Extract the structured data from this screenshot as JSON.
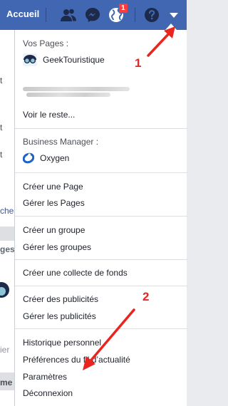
{
  "topbar": {
    "home_label": "Accueil",
    "notification_badge": "1",
    "colors": {
      "background": "#4267b2",
      "badge": "#fa3e3e"
    },
    "icons": [
      "friends-icon",
      "messenger-icon",
      "globe-icon",
      "help-icon",
      "dropdown-caret-icon"
    ]
  },
  "background_page": {
    "fragments": [
      "t",
      "t",
      "t",
      "che",
      "ges",
      "ier",
      "me"
    ]
  },
  "menu": {
    "pages_title": "Vos Pages :",
    "page_1": "GeekTouristique",
    "see_more": "Voir le reste...",
    "business_title": "Business Manager :",
    "business_1": "Oxygen",
    "create_page": "Créer une Page",
    "manage_pages": "Gérer les Pages",
    "create_group": "Créer un groupe",
    "manage_groups": "Gérer les groupes",
    "create_fundraiser": "Créer une collecte de fonds",
    "create_ads": "Créer des publicités",
    "manage_ads": "Gérer les publicités",
    "history": "Historique personnel",
    "news_feed_prefs": "Préférences du fil d’actualité",
    "settings": "Paramètres",
    "logout": "Déconnexion"
  },
  "annotations": {
    "marker_1": "1",
    "marker_2": "2",
    "color": "#e8261f"
  }
}
